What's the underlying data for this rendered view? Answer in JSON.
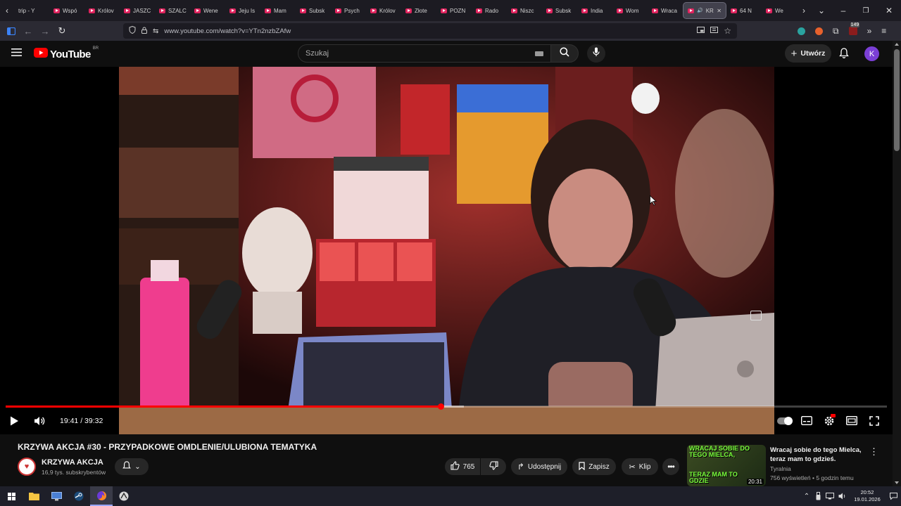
{
  "browser": {
    "tabs": [
      {
        "label": "trip - Y",
        "has_favicon": false
      },
      {
        "label": "Wspó"
      },
      {
        "label": "Królov"
      },
      {
        "label": "JASZC"
      },
      {
        "label": "SZALC"
      },
      {
        "label": "Wene"
      },
      {
        "label": "Jeju Is"
      },
      {
        "label": "Mam"
      },
      {
        "label": "Subsk"
      },
      {
        "label": "Psych"
      },
      {
        "label": "Królov"
      },
      {
        "label": "Złote"
      },
      {
        "label": "POZN"
      },
      {
        "label": "Rado"
      },
      {
        "label": "Niszc"
      },
      {
        "label": "Subsk"
      },
      {
        "label": "India"
      },
      {
        "label": "Wom"
      },
      {
        "label": "Wraca"
      },
      {
        "label": "KR",
        "active": true
      },
      {
        "label": "64 N"
      },
      {
        "label": "We"
      }
    ],
    "url": "www.youtube.com/watch?v=YTn2nzbZAfw",
    "extension_badge": "149"
  },
  "youtube": {
    "logo_text": "YouTube",
    "country_code": "BR",
    "search_placeholder": "Szukaj",
    "create_label": "Utwórz",
    "avatar_letter": "K"
  },
  "player": {
    "time_current": "19:41",
    "time_total": "39:32",
    "progress_fraction": 0.494,
    "buffered_fraction": 0.52
  },
  "video": {
    "title": "KRZYWA AKCJA #30 - PRZYPADKOWE OMDLENIE/ULUBIONA TEMATYKA",
    "channel_name": "KRZYWA AKCJA",
    "subscribers": "16,9 tys. subskrybentów",
    "likes": "765",
    "share_label": "Udostępnij",
    "save_label": "Zapisz",
    "clip_label": "Klip"
  },
  "recommendation": {
    "title": "Wracaj sobie do tego Mielca, teraz mam to gdzieś.",
    "channel": "Tyralnia",
    "meta": "756 wyświetleń • 5 godzin temu",
    "duration": "20:31",
    "thumb_text_top": "WRACAJ SOBIE DO TEGO MIELCA,",
    "thumb_text_bottom": "TERAZ MAM TO GDZIE"
  },
  "taskbar": {
    "time": "20:52",
    "date": "19.01.2026"
  },
  "colors": {
    "accent_red": "#ff0000",
    "progress_red": "#f00",
    "avatar_purple": "#7b3fd6",
    "yt_bg": "#0f0f0f"
  }
}
